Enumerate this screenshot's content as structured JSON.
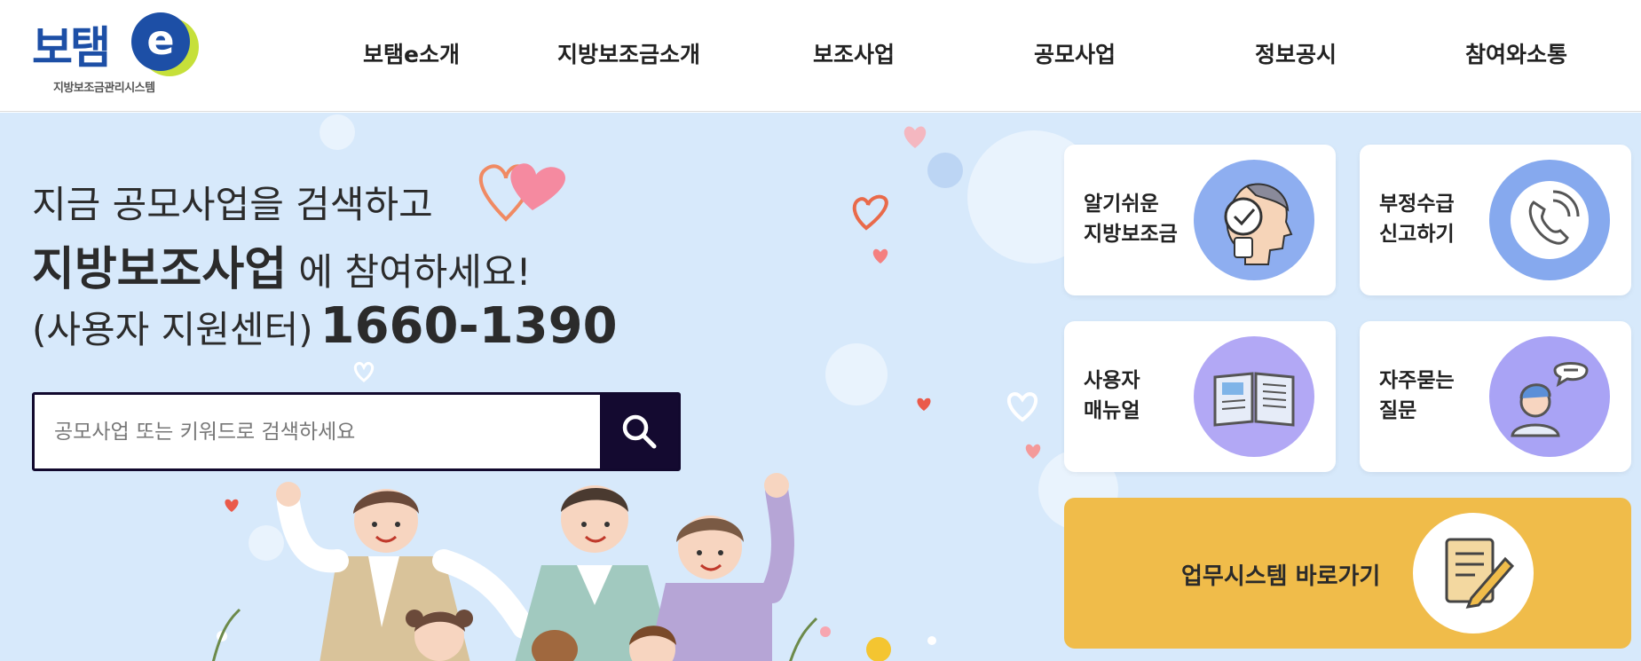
{
  "header": {
    "logo_text": "보탬",
    "logo_e": "e",
    "logo_sub": "지방보조금관리시스템",
    "nav": [
      "보탬e소개",
      "지방보조금소개",
      "보조사업",
      "공모사업",
      "정보공시",
      "참여와소통"
    ]
  },
  "hero": {
    "line1": "지금 공모사업을 검색하고",
    "line2_strong": "지방보조사업",
    "line2_rest": " 에 참여하세요!",
    "line3_prefix": "(사용자 지원센터)",
    "phone": "1660-1390",
    "search_placeholder": "공모사업 또는 키워드로 검색하세요"
  },
  "cards": [
    {
      "line1": "알기쉬운",
      "line2": "지방보조금",
      "icon": "head-check-icon",
      "color": "#8eaef0"
    },
    {
      "line1": "부정수급",
      "line2": "신고하기",
      "icon": "phone-icon",
      "color": "#86a9ee"
    },
    {
      "line1": "사용자",
      "line2": "매뉴얼",
      "icon": "book-icon",
      "color": "#b2a8f5"
    },
    {
      "line1": "자주묻는",
      "line2": "질문",
      "icon": "chat-person-icon",
      "color": "#a9a3f5"
    }
  ],
  "work_system": {
    "label": "업무시스템 바로가기",
    "icon": "document-pen-icon",
    "color": "#f0bc4a"
  }
}
